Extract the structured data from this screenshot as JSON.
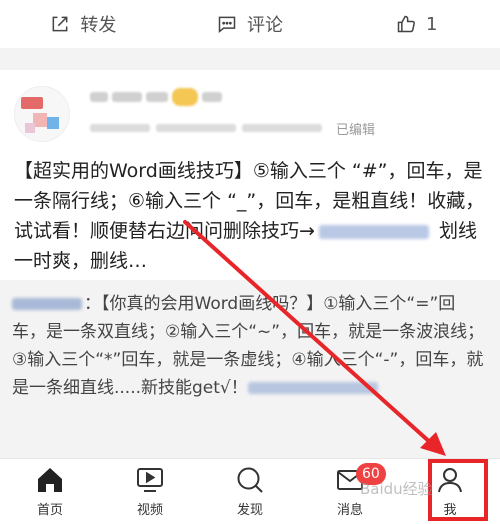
{
  "action_bar": {
    "share_label": "转发",
    "comment_label": "评论",
    "like_count": "1"
  },
  "post": {
    "edited_label": "已编辑",
    "text_part1": "【超实用的Word画线技巧】⑤输入三个 “#”，回车，是一条隔行线；⑥输入三个 “_”，回车，是粗直线！收藏，试试看！顺便替右边问问删除技巧→",
    "text_part2": " 划线一时爽，删线…",
    "quote": {
      "text": "：【你真的会用Word画线吗？】①输入三个“=”回车，是一条双直线；②输入三个“~”，回车，就是一条波浪线；③输入三个“*”回车，就是一条虚线；④输入三个“-”，回车，就是一条细直线.....新技能get√！"
    }
  },
  "tabbar": {
    "home": "首页",
    "video": "视频",
    "discover": "发现",
    "messages": "消息",
    "messages_badge": "60",
    "me": "我"
  },
  "colors": {
    "accent_red": "#e8262a",
    "badge_red": "#f04142"
  },
  "watermark": "Baidu经验"
}
